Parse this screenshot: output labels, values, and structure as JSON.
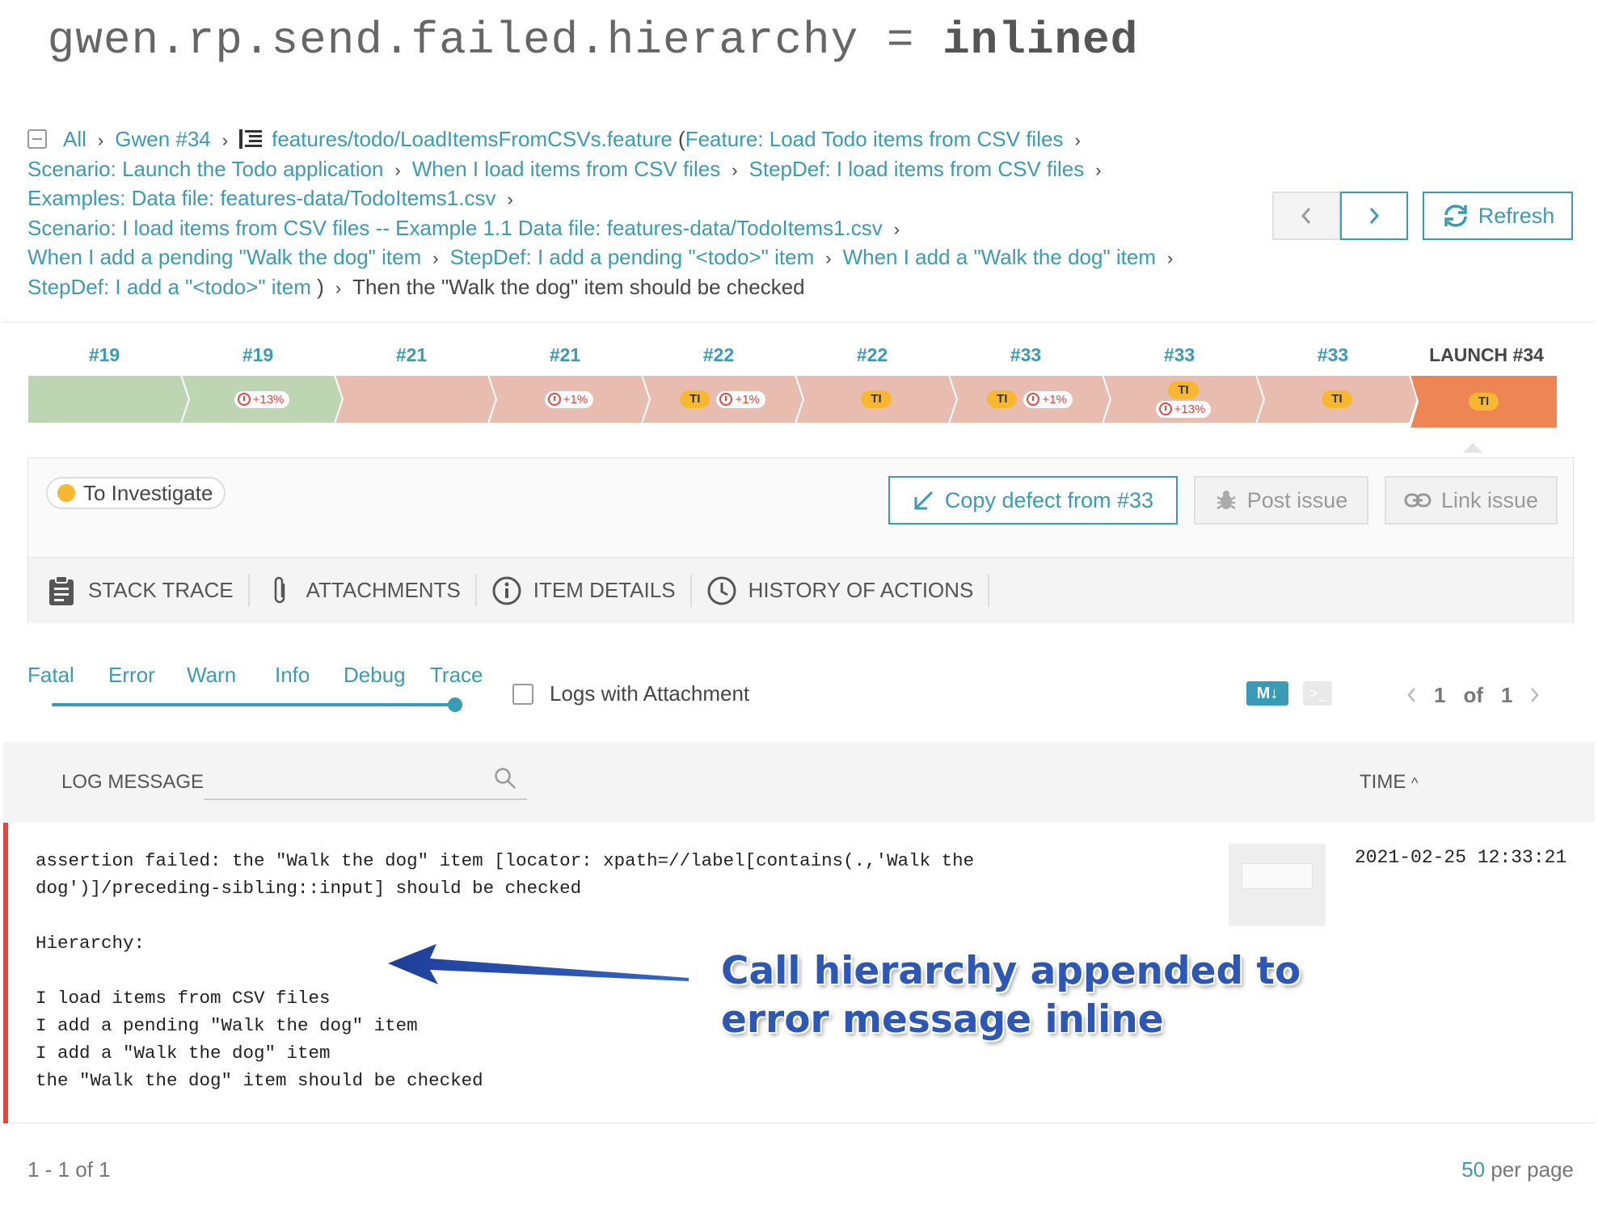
{
  "header": {
    "config_key": "gwen.rp.send.failed.hierarchy",
    "equals": "=",
    "config_value": "inlined"
  },
  "breadcrumbs": {
    "all": "All",
    "launch": "Gwen #34",
    "feature_file": "features/todo/LoadItemsFromCSVs.feature",
    "open_paren": "(",
    "feature": "Feature: Load Todo items from CSV files",
    "scenario_launch": "Scenario: Launch the Todo application",
    "when_load": "When I load items from CSV files",
    "stepdef_load": "StepDef: I load items from CSV files",
    "examples": "Examples: Data file: features-data/TodoItems1.csv",
    "scenario_load": "Scenario: I load items from CSV files -- Example 1.1 Data file: features-data/TodoItems1.csv",
    "when_pending": "When I add a pending \"Walk the dog\" item",
    "stepdef_pending": "StepDef: I add a pending \"<todo>\" item",
    "when_add": "When I add a \"Walk the dog\" item",
    "stepdef_add": "StepDef: I add a \"<todo>\" item",
    "close_paren": ")",
    "current": "Then the \"Walk the dog\" item should be checked",
    "separator": "›"
  },
  "toolbar": {
    "prev_icon": "chevron-left-icon",
    "next_icon": "chevron-right-icon",
    "refresh_label": "Refresh"
  },
  "history": {
    "items": [
      {
        "label": "#19",
        "status": "passed",
        "ti": false,
        "growth": ""
      },
      {
        "label": "#19",
        "status": "passed",
        "ti": false,
        "growth": "+13%"
      },
      {
        "label": "#21",
        "status": "failed",
        "ti": false,
        "growth": ""
      },
      {
        "label": "#21",
        "status": "failed",
        "ti": false,
        "growth": "+1%"
      },
      {
        "label": "#22",
        "status": "failed",
        "ti": true,
        "growth": "+1%"
      },
      {
        "label": "#22",
        "status": "failed",
        "ti": true,
        "growth": ""
      },
      {
        "label": "#33",
        "status": "failed",
        "ti": true,
        "growth": "+1%"
      },
      {
        "label": "#33",
        "status": "failed",
        "ti": true,
        "growth": "+13%",
        "stacked": true
      },
      {
        "label": "#33",
        "status": "failed",
        "ti": true,
        "growth": ""
      },
      {
        "label": "LAUNCH #34",
        "status": "current",
        "ti": true,
        "growth": ""
      }
    ],
    "ti_label": "TI",
    "colors": {
      "passed": "#bdd5b3",
      "failed": "#e8bcae",
      "current": "#ee8554"
    }
  },
  "defect": {
    "type_label": "To Investigate",
    "type_color": "#f7b731",
    "copy_label": "Copy defect from #33",
    "post_label": "Post issue",
    "link_label": "Link issue"
  },
  "tabs": [
    {
      "label": "STACK TRACE",
      "icon": "clipboard-icon"
    },
    {
      "label": "ATTACHMENTS",
      "icon": "paperclip-icon"
    },
    {
      "label": "ITEM DETAILS",
      "icon": "info-icon"
    },
    {
      "label": "HISTORY OF ACTIONS",
      "icon": "clock-icon"
    }
  ],
  "log_levels": {
    "levels": [
      "Fatal",
      "Error",
      "Warn",
      "Info",
      "Debug",
      "Trace"
    ],
    "selected": "Trace",
    "attachment_filter_label": "Logs with Attachment",
    "markdown_label": "M↓",
    "console_label": ">_"
  },
  "pager": {
    "current": "1",
    "of": "of",
    "total": "1"
  },
  "log_table": {
    "message_header": "LOG MESSAGE",
    "time_header": "TIME",
    "sort_indicator": "^",
    "rows": [
      {
        "level": "error",
        "message": "assertion failed: the \"Walk the dog\" item [locator: xpath=//label[contains(.,'Walk the\ndog')]/preceding-sibling::input] should be checked\n\nHierarchy:\n\nI load items from CSV files\nI add a pending \"Walk the dog\" item\nI add a \"Walk the dog\" item\nthe \"Walk the dog\" item should be checked",
        "time": "2021-02-25 12:33:21"
      }
    ]
  },
  "annotation": {
    "line1": "Call hierarchy appended to",
    "line2": "error message inline"
  },
  "footer": {
    "count": "1 - 1 of 1",
    "per_page_value": "50",
    "per_page_label": "per page"
  }
}
